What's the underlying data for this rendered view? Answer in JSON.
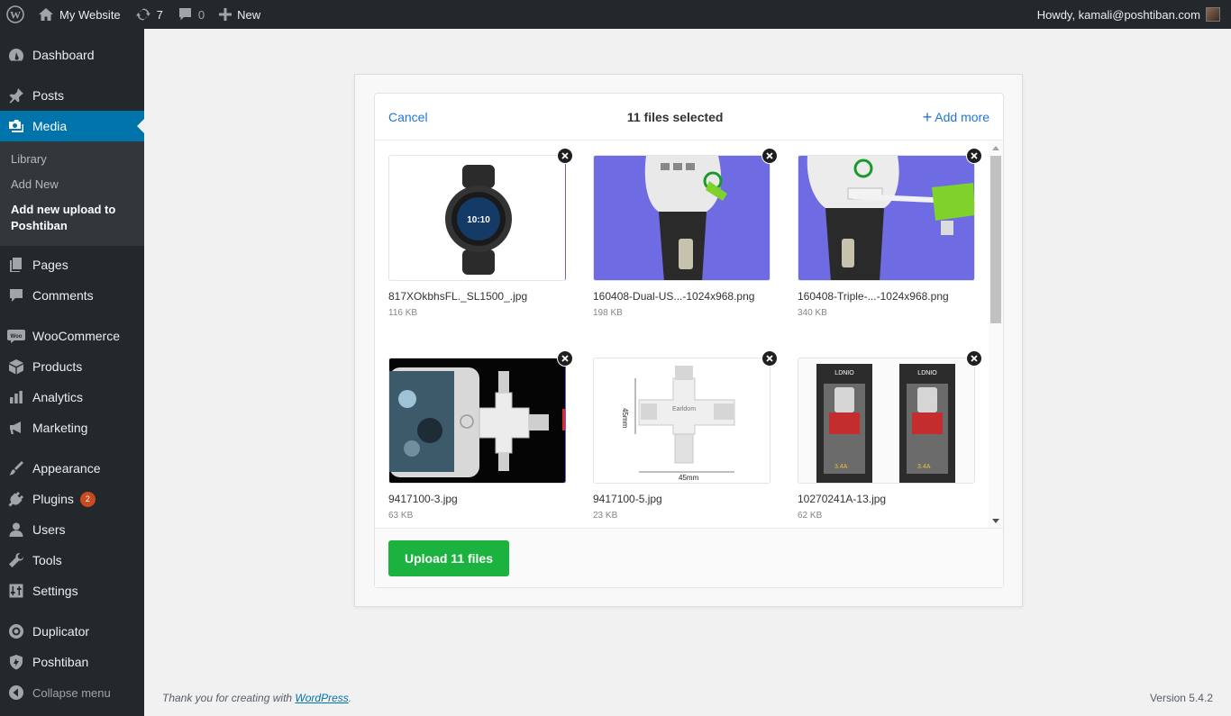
{
  "adminbar": {
    "site_name": "My Website",
    "updates_count": "7",
    "comments_count": "0",
    "new_label": "New",
    "greeting": "Howdy, kamali@poshtiban.com"
  },
  "sidebar": {
    "dashboard": "Dashboard",
    "posts": "Posts",
    "media": "Media",
    "media_sub": [
      "Library",
      "Add New",
      "Add new upload to Poshtiban"
    ],
    "pages": "Pages",
    "comments": "Comments",
    "woocommerce": "WooCommerce",
    "products": "Products",
    "analytics": "Analytics",
    "marketing": "Marketing",
    "appearance": "Appearance",
    "plugins": "Plugins",
    "plugins_badge": "2",
    "users": "Users",
    "tools": "Tools",
    "settings": "Settings",
    "duplicator": "Duplicator",
    "poshtiban": "Poshtiban",
    "collapse": "Collapse menu"
  },
  "uploader": {
    "cancel_label": "Cancel",
    "files_selected": "11 files selected",
    "add_more_label": "Add more",
    "upload_button": "Upload 11 files",
    "files": [
      {
        "name": "817XOkbhsFL._SL1500_.jpg",
        "size": "116 KB"
      },
      {
        "name": "160408-Dual-US...-1024x968.png",
        "size": "198 KB"
      },
      {
        "name": "160408-Triple-...-1024x968.png",
        "size": "340 KB"
      },
      {
        "name": "9417100-3.jpg",
        "size": "63 KB"
      },
      {
        "name": "9417100-5.jpg",
        "size": "23 KB"
      },
      {
        "name": "10270241A-13.jpg",
        "size": "62 KB"
      }
    ],
    "thumb_text": {
      "watch_time": "10:10",
      "dim_vertical": "45mm",
      "dim_horizontal": "45mm",
      "brand": "Earldom",
      "ldnio_brand": "LDNIO",
      "ldnio_current": "3.4A"
    }
  },
  "footer": {
    "thanks_prefix": "Thank you for creating with ",
    "wp_link": "WordPress",
    "thanks_suffix": ".",
    "version": "Version 5.4.2"
  },
  "colors": {
    "accent": "#0073aa",
    "upload_button": "#1bb240",
    "link": "#2275d7",
    "adminbar_bg": "#23282d"
  }
}
